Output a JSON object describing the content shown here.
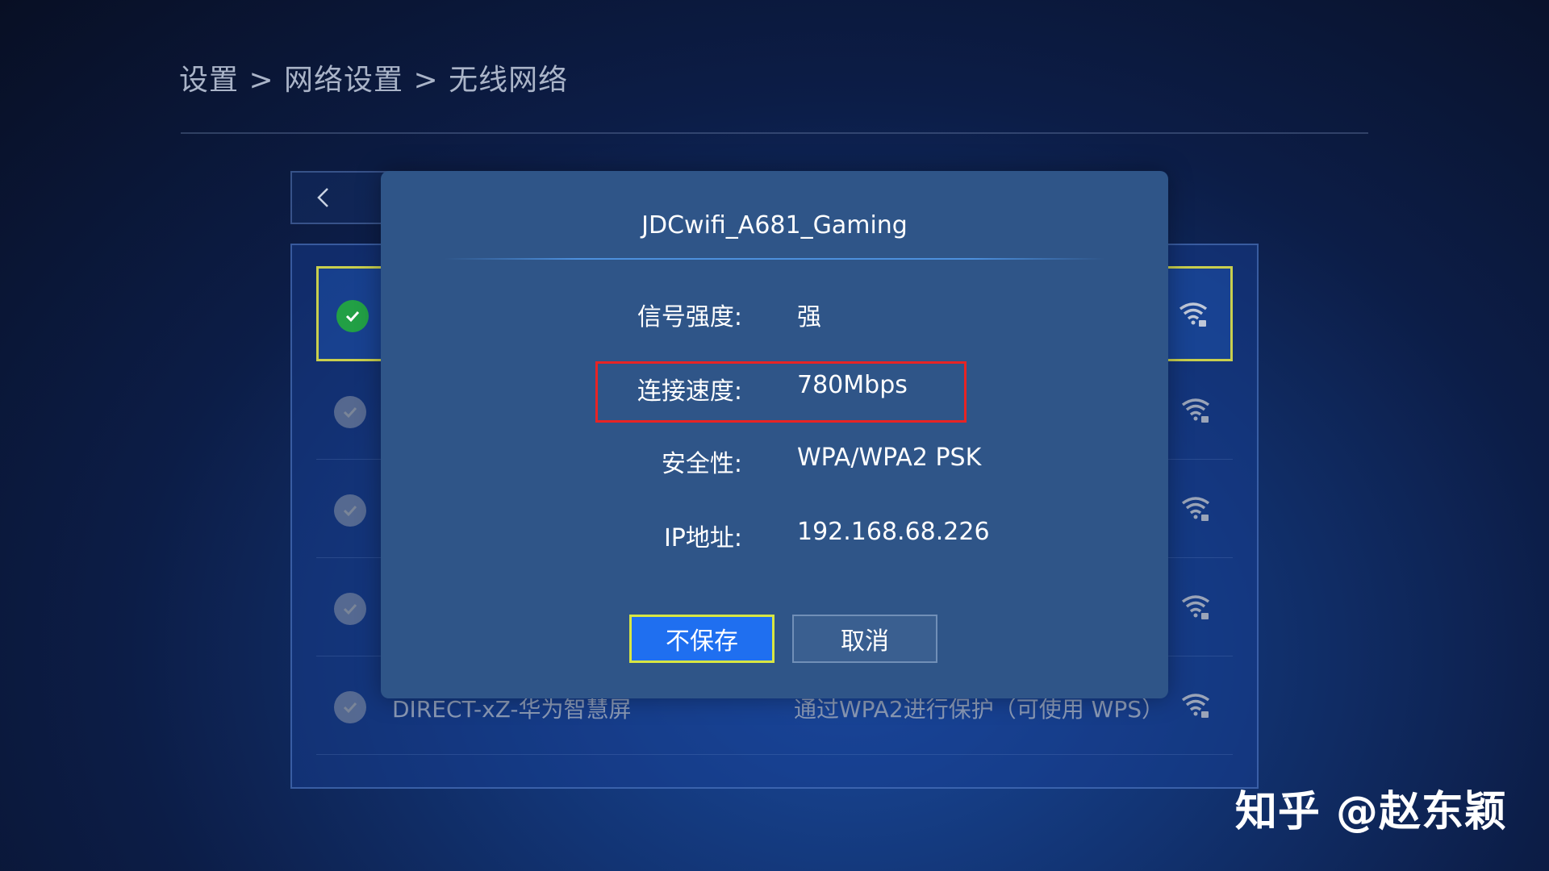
{
  "breadcrumb": "设置 > 网络设置 > 无线网络",
  "network_list": {
    "rows": [
      {
        "name": "",
        "security": ""
      },
      {
        "name": "",
        "security": ""
      },
      {
        "name": "",
        "security": ""
      },
      {
        "name": "",
        "security": ""
      },
      {
        "name": "DIRECT-xZ-华为智慧屏",
        "security": "通过WPA2进行保护（可使用 WPS）"
      }
    ]
  },
  "dialog": {
    "title": "JDCwifi_A681_Gaming",
    "signal_label": "信号强度:",
    "signal_value": "强",
    "speed_label": "连接速度:",
    "speed_value": "780Mbps",
    "security_label": "安全性:",
    "security_value": "WPA/WPA2 PSK",
    "ip_label": "IP地址:",
    "ip_value": "192.168.68.226",
    "forget_button": "不保存",
    "cancel_button": "取消"
  },
  "watermark": "知乎 @赵东颖",
  "colors": {
    "highlight": "#e82424",
    "focus_border": "#d8e642",
    "primary_button": "#1f6ff0",
    "connected_check": "#22a045"
  }
}
